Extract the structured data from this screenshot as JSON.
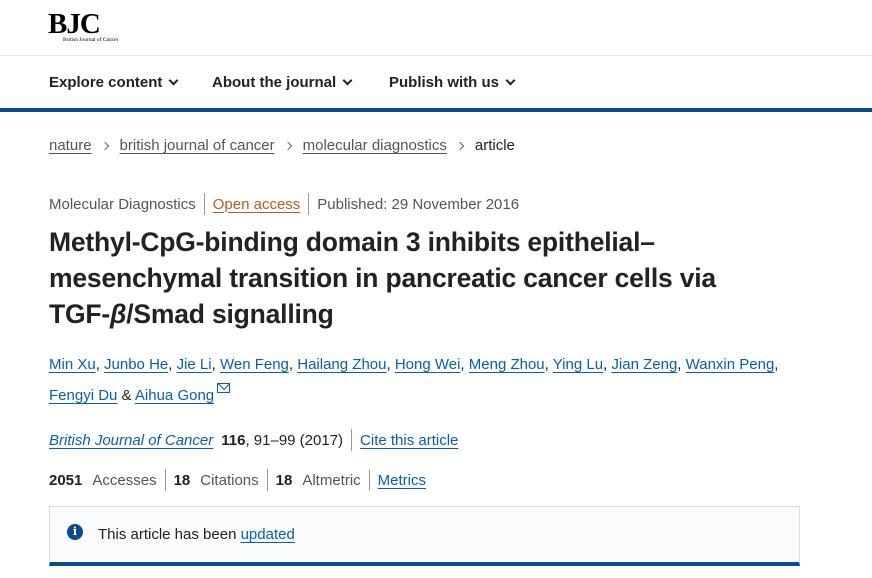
{
  "logo": {
    "mark": "BJC",
    "subtitle": "British Journal of Cancer"
  },
  "nav": {
    "items": [
      {
        "label": "Explore content"
      },
      {
        "label": "About the journal"
      },
      {
        "label": "Publish with us"
      }
    ]
  },
  "breadcrumb": {
    "items": [
      "nature",
      "british journal of cancer",
      "molecular diagnostics"
    ],
    "current": "article"
  },
  "meta": {
    "section": "Molecular Diagnostics",
    "access": "Open access",
    "published": "Published: 29 November 2016"
  },
  "article": {
    "title_line1": "Methyl-CpG-binding domain 3 inhibits epithelial–",
    "title_line2": "mesenchymal transition in pancreatic cancer cells via",
    "title_line3_prefix": "TGF-",
    "title_beta": "β",
    "title_line3_suffix": "/Smad signalling"
  },
  "authors": [
    "Min Xu",
    "Junbo He",
    "Jie Li",
    "Wen Feng",
    "Hailang Zhou",
    "Hong Wei",
    "Meng Zhou",
    "Ying Lu",
    "Jian Zeng",
    "Wanxin Peng",
    "Fengyi Du",
    "Aihua Gong"
  ],
  "authors_joiner": "&",
  "citation": {
    "journal": "British Journal of Cancer",
    "volume": "116",
    "pages": ", 91–99 (2017)",
    "cite_label": "Cite this article"
  },
  "metrics": {
    "accesses_value": "2051",
    "accesses_label": "Accesses",
    "citations_value": "18",
    "citations_label": "Citations",
    "altmetric_value": "18",
    "altmetric_label": "Altmetric",
    "metrics_link": "Metrics"
  },
  "notice": {
    "text": "This article has been ",
    "link": "updated",
    "icon": "info-icon"
  },
  "colors": {
    "brand_blue": "#0a4b8f",
    "link_blue": "#0a5fa8",
    "open_access_orange": "#b95b1e"
  }
}
